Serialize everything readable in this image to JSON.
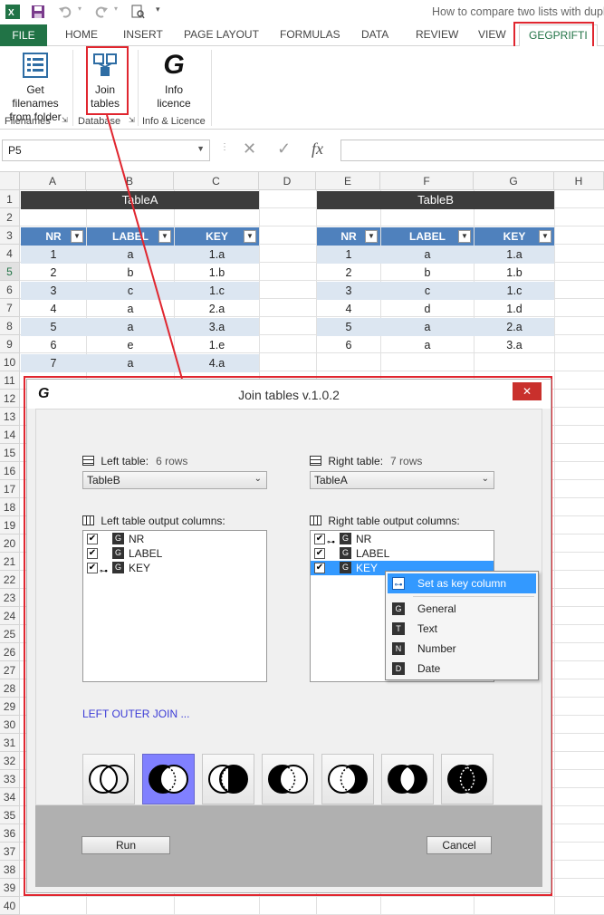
{
  "window": {
    "title": "How to compare two lists with dupl"
  },
  "tabs": [
    {
      "label": "FILE"
    },
    {
      "label": "HOME"
    },
    {
      "label": "INSERT"
    },
    {
      "label": "PAGE LAYOUT"
    },
    {
      "label": "FORMULAS"
    },
    {
      "label": "DATA"
    },
    {
      "label": "REVIEW"
    },
    {
      "label": "VIEW"
    },
    {
      "label": "GEGPRIFTI"
    }
  ],
  "ribbon": {
    "buttons": [
      {
        "line1": "Get filenames",
        "line2": "from folder"
      },
      {
        "line1": "Join",
        "line2": "tables"
      },
      {
        "line1": "Info",
        "line2": "licence"
      }
    ],
    "groups": [
      "Filenames",
      "Database",
      "Info & Licence"
    ]
  },
  "formula_bar": {
    "name_box": "P5",
    "fx": "fx",
    "formula": ""
  },
  "columns": [
    "A",
    "B",
    "C",
    "D",
    "E",
    "F",
    "G",
    "H"
  ],
  "rows": [
    "1",
    "2",
    "3",
    "4",
    "5",
    "6",
    "7",
    "8",
    "9",
    "10",
    "11",
    "12",
    "13",
    "14",
    "15",
    "16",
    "17",
    "18",
    "19",
    "20",
    "21",
    "22",
    "23",
    "24",
    "25",
    "26",
    "27",
    "28",
    "29",
    "30",
    "31",
    "32",
    "33",
    "34",
    "35",
    "36",
    "37",
    "38",
    "39",
    "40"
  ],
  "tableA": {
    "title": "TableA",
    "headers": [
      "NR",
      "LABEL",
      "KEY"
    ],
    "rows": [
      [
        "1",
        "a",
        "1.a"
      ],
      [
        "2",
        "b",
        "1.b"
      ],
      [
        "3",
        "c",
        "1.c"
      ],
      [
        "4",
        "a",
        "2.a"
      ],
      [
        "5",
        "a",
        "3.a"
      ],
      [
        "6",
        "e",
        "1.e"
      ],
      [
        "7",
        "a",
        "4.a"
      ]
    ]
  },
  "tableB": {
    "title": "TableB",
    "headers": [
      "NR",
      "LABEL",
      "KEY"
    ],
    "rows": [
      [
        "1",
        "a",
        "1.a"
      ],
      [
        "2",
        "b",
        "1.b"
      ],
      [
        "3",
        "c",
        "1.c"
      ],
      [
        "4",
        "d",
        "1.d"
      ],
      [
        "5",
        "a",
        "2.a"
      ],
      [
        "6",
        "a",
        "3.a"
      ]
    ]
  },
  "dialog": {
    "title": "Join tables v.1.0.2",
    "logo": "G",
    "close": "✕",
    "left": {
      "label": "Left table:",
      "rows": "6 rows",
      "selected": "TableB",
      "columns_label": "Left table output columns:",
      "columns": [
        "NR",
        "LABEL",
        "KEY"
      ]
    },
    "right": {
      "label": "Right table:",
      "rows": "7 rows",
      "selected": "TableA",
      "columns_label": "Right table output columns:",
      "columns": [
        "NR",
        "LABEL",
        "KEY"
      ]
    },
    "join_label": "LEFT OUTER JOIN ...",
    "run": "Run",
    "cancel": "Cancel"
  },
  "context_menu": {
    "items": [
      {
        "icon": "key",
        "label": "Set as key column"
      },
      {
        "icon": "G",
        "label": "General"
      },
      {
        "icon": "T",
        "label": "Text"
      },
      {
        "icon": "N",
        "label": "Number"
      },
      {
        "icon": "D",
        "label": "Date"
      }
    ]
  },
  "colors": {
    "excel_green": "#217346",
    "table_header": "#4f81bd",
    "band": "#dce6f1",
    "highlight": "#e0262f",
    "selected_join": "#8080ff"
  }
}
